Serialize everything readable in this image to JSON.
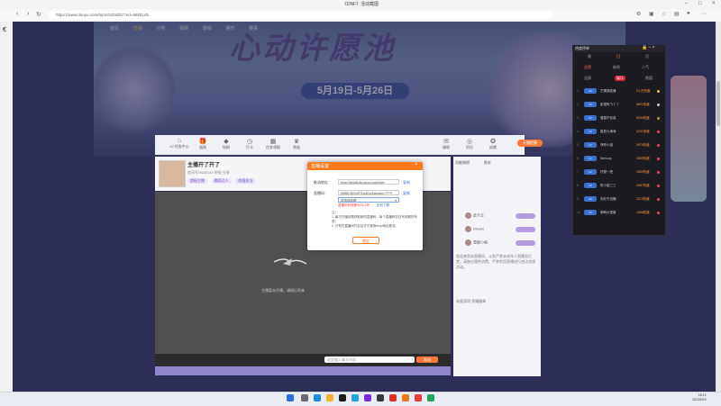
{
  "window": {
    "title": "《DNF》活动截图"
  },
  "browser": {
    "url": "https://www.douyu.com/topic/520sbhz?rid=9685145"
  },
  "site": {
    "nav": [
      "首页",
      "直播",
      "分类",
      "视频",
      "游戏",
      "娱乐",
      "赛事"
    ],
    "banner_title": "心动许愿池",
    "banner_dates": "5月19日-5月26日"
  },
  "room": {
    "toolbar": [
      "12 任务中心",
      "道具",
      "钻粉",
      "打卡",
      "任务领取",
      "贵族",
      "超粉",
      "福袋",
      "积分",
      "成就",
      "活动"
    ],
    "open_badge": "开播提醒",
    "streamer_name": "主播开了开了",
    "meta": "房间号:9685145  举报  分享",
    "tags": [
      "超级主播",
      "舞蹈达人",
      "颜值担当"
    ],
    "video_msg": "主播暂未开播，请稍后再来",
    "danmu_placeholder": "这里输入聊天内容...",
    "send_label": "发送"
  },
  "chat": {
    "tabs": [
      "贡献周榜",
      "贵宾"
    ],
    "rows": [
      "皮卡丘",
      "Dream",
      "雪碧小姐"
    ],
    "text": "欢迎来到本直播间，斗鱼严禁未成年人直播及打赏，请各位理性消费，严禁利用直播进行违法违规活动。",
    "footer": "恭喜获得 荣耀徽章"
  },
  "dialog": {
    "title": "直播设置",
    "server_label": "推流地址：",
    "server_value": "rtmp://sendtc3a.douyu.com/live",
    "copy1": "复制",
    "key_label": "直播码：",
    "key_value": "9685145rToRTUx4IUz1stream=******",
    "copy2": "复制",
    "select_value": "请选择线路",
    "warn": "直播码有效期为24小时",
    "learn": "如何了解",
    "notes": [
      "注：",
      "1. 每次开播前需获取新的直播码，每个直播码仅在有效期内有效；",
      "2. 只有在直播间开启后才可使用rtmp地址推流。"
    ],
    "ok": "确定"
  },
  "rank": {
    "title": "热度榜单",
    "tabs": [
      "周",
      "日",
      "月"
    ],
    "sections": [
      "总榜",
      "新秀",
      "人气"
    ],
    "subs": [
      "全部",
      "娱乐",
      "颜值"
    ],
    "rows": [
      {
        "n": "1",
        "badge": "LV",
        "name": "芒果捕捉器",
        "val": "9.1万热度",
        "color": "#f5c04a"
      },
      {
        "n": "2",
        "badge": "LV",
        "name": "影视阿飞丫丫",
        "val": "8821热度",
        "color": "#c9c9c9"
      },
      {
        "n": "3",
        "badge": "LV",
        "name": "雪碧不化装",
        "val": "6344热度",
        "color": "#d08a44"
      },
      {
        "n": "4",
        "badge": "LV",
        "name": "星辰大海海",
        "val": "4231热度",
        "color": "#f04545"
      },
      {
        "n": "5",
        "badge": "LV",
        "name": "菲菲小姐",
        "val": "3976热度",
        "color": "#f04545"
      },
      {
        "n": "6",
        "badge": "LV",
        "name": "Mercury",
        "val": "3055热度",
        "color": "#f04545"
      },
      {
        "n": "7",
        "badge": "LV",
        "name": "柠檬一把",
        "val": "2960热度",
        "color": "#f04545"
      },
      {
        "n": "8",
        "badge": "LV",
        "name": "夜小猫三三",
        "val": "2487热度",
        "color": "#f04545"
      },
      {
        "n": "9",
        "badge": "LV",
        "name": "彩虹不加糖",
        "val": "2210热度",
        "color": "#f04545"
      },
      {
        "n": "10",
        "badge": "LV",
        "name": "萌萌大怪兽",
        "val": "1966热度",
        "color": "#f04545"
      }
    ]
  },
  "taskbar": {
    "time": "18:12",
    "date": "2023/5/19"
  }
}
